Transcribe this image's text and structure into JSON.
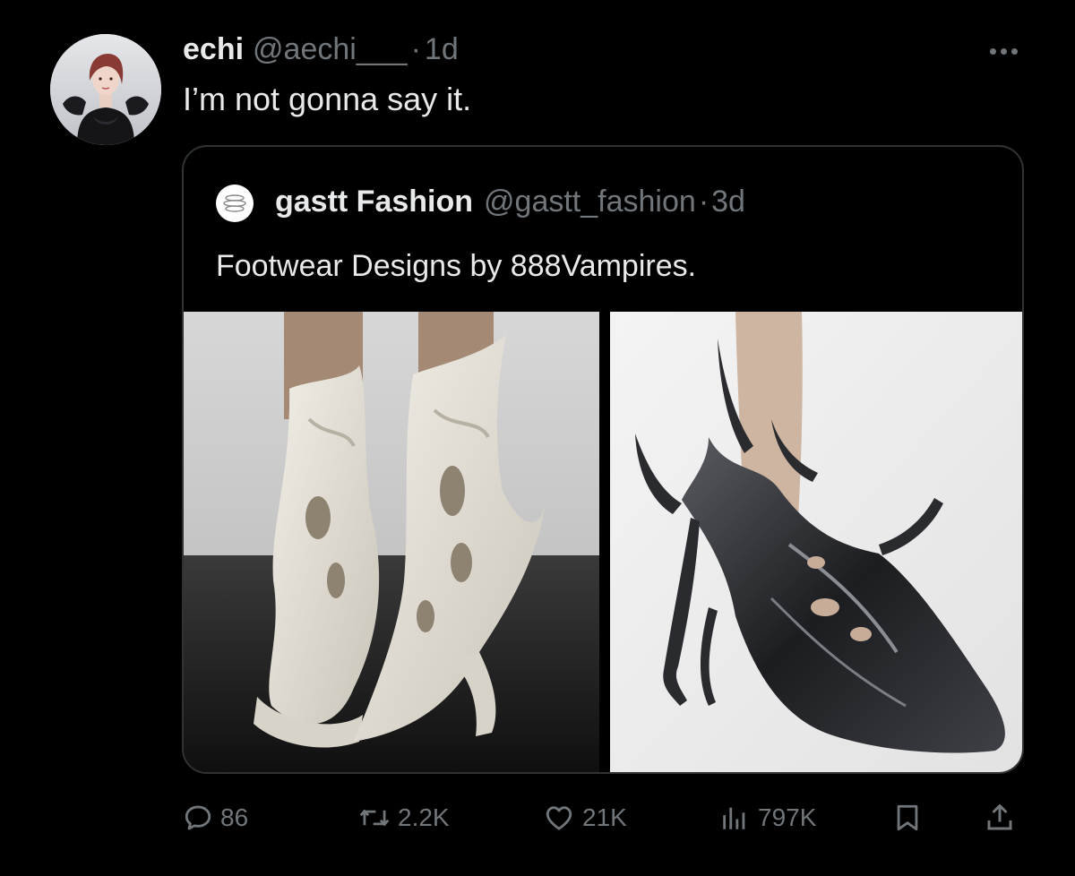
{
  "tweet": {
    "author_name": "echi",
    "author_handle": "@aechi___",
    "separator": "·",
    "time": "1d",
    "text": "I’m not gonna say it.",
    "more_icon": "more-horizontal-icon"
  },
  "quoted_tweet": {
    "author_name": "gastt Fashion",
    "author_handle": "@gastt_fashion",
    "separator": "·",
    "time": "3d",
    "text": "Footwear Designs by 888Vampires.",
    "images": [
      {
        "name": "white-sculptural-boots-image"
      },
      {
        "name": "black-sculptural-heel-image"
      }
    ]
  },
  "actions": {
    "reply": {
      "icon": "reply-icon",
      "count": "86"
    },
    "retweet": {
      "icon": "retweet-icon",
      "count": "2.2K"
    },
    "like": {
      "icon": "like-icon",
      "count": "21K"
    },
    "views": {
      "icon": "views-icon",
      "count": "797K"
    },
    "bookmark": {
      "icon": "bookmark-icon"
    },
    "share": {
      "icon": "share-icon"
    }
  },
  "colors": {
    "background": "#000000",
    "text_primary": "#e7e9ea",
    "text_secondary": "#71767b",
    "border": "#2f3336"
  }
}
